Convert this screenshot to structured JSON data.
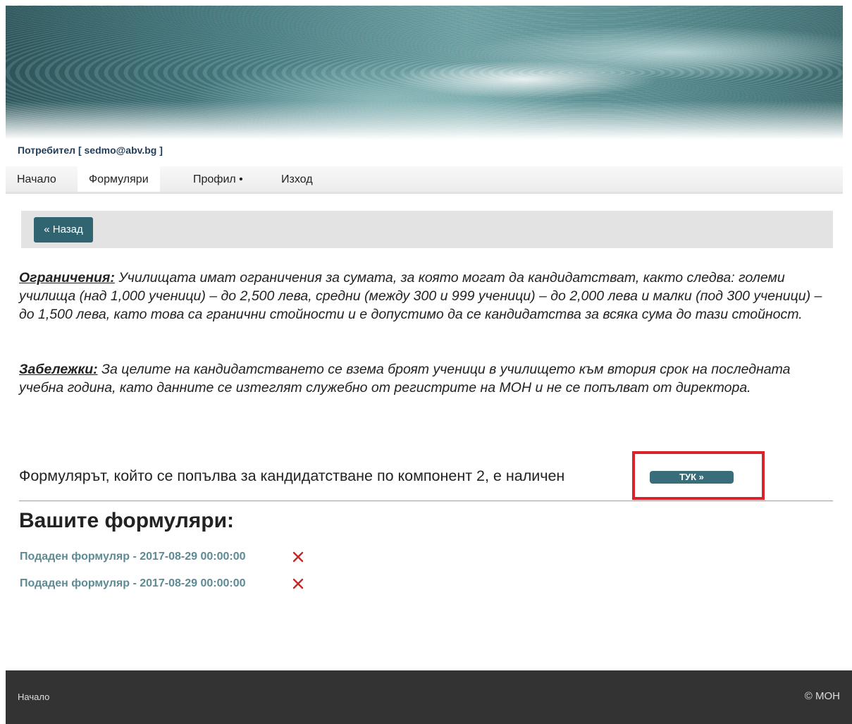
{
  "user": {
    "text": "Потребител [ sedmo@abv.bg ]"
  },
  "nav": {
    "home": "Начало",
    "forms": "Формуляри",
    "profile": "Профил •",
    "logout": "Изход"
  },
  "toolbar": {
    "back_label": "« Назад"
  },
  "restrictions": {
    "label": "Ограничения:",
    "text": " Училищата имат ограничения за сумата, за която могат да кандидатстват, както следва: големи училища (над 1,000 ученици) – до 2,500 лева, средни (между 300 и 999 ученици) – до 2,000 лева и малки (под 300 ученици) – до 1,500 лева, като това са гранични стойности и е допустимо да се кандидатства за всяка сума до тази стойност."
  },
  "notes": {
    "label": "Забележки:",
    "text": " За целите на кандидатстването се взема броят ученици в училището към втория срок на последната учебна година, като данните се изтеглят служебно от регистрите на МОН и не се попълват от директора."
  },
  "form_notice": {
    "text": "Формулярът, който се попълва за кандидатстване по компонент 2, е наличен",
    "button_label": "ТУК »"
  },
  "your_forms": {
    "title": "Вашите формуляри:",
    "items": [
      {
        "label": "Подаден формуляр - 2017-08-29 00:00:00"
      },
      {
        "label": "Подаден формуляр - 2017-08-29 00:00:00"
      }
    ]
  },
  "footer": {
    "link": "Начало",
    "copyright": "© МОН"
  },
  "colors": {
    "accent": "#2f6470",
    "highlight": "#d8232a",
    "link": "#5e8a93",
    "footer_bg": "#333333"
  }
}
